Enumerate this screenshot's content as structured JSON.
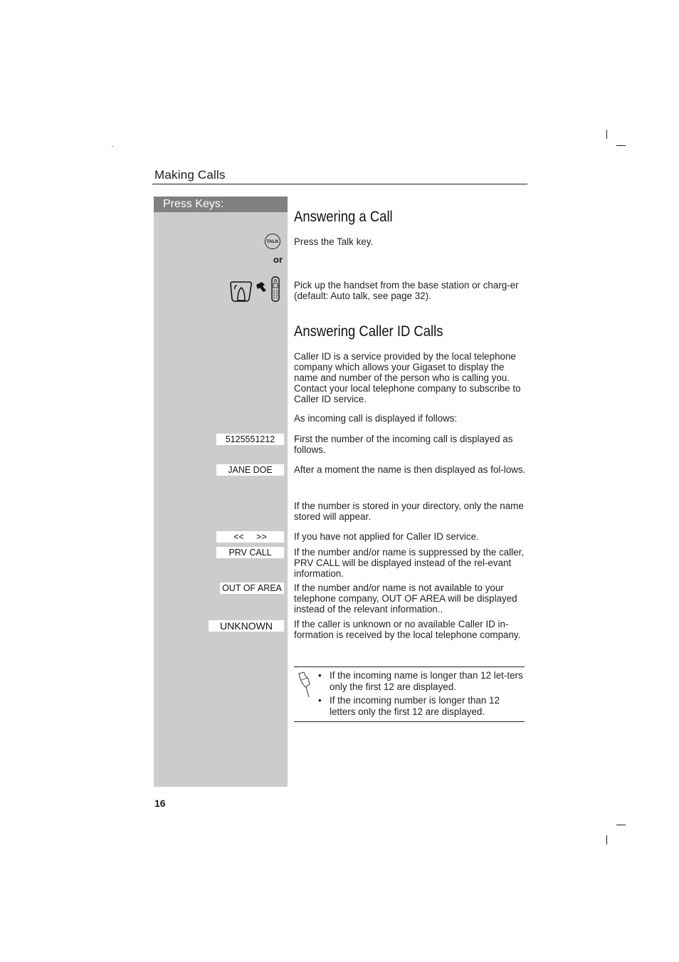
{
  "header": {
    "section_title": "Making Calls"
  },
  "sidebar": {
    "heading": "Press Keys:",
    "or_label": "or",
    "talk_key_label": "TALK"
  },
  "sections": [
    {
      "title": "Answering a Call"
    },
    {
      "title": "Answering Caller ID Calls"
    }
  ],
  "answering": {
    "talk_text": "Press the Talk key.",
    "pickup_text": "Pick up the handset from the base station or charg-er (default: Auto talk, see page 32)."
  },
  "caller_id": {
    "intro": "Caller ID is a service provided by the local telephone company which allows your Gigaset to display the name and number of the person who is calling you. Contact your local telephone company to subscribe to Caller ID service.",
    "as_incoming": "As incoming call is displayed if follows:",
    "rows": [
      {
        "display": "5125551212",
        "text": "First the number of the incoming call is displayed as follows."
      },
      {
        "display": "JANE DOE",
        "text": "After a moment the name is then displayed as fol-lows."
      },
      {
        "display": "",
        "text": "If the number is stored in your directory, only the name stored will appear."
      },
      {
        "display": "<<     >>",
        "text": "If you have not applied for Caller ID service."
      },
      {
        "display": "PRV CALL",
        "text": "If the number and/or name is suppressed by the caller, PRV CALL will be displayed instead of the rel-evant information."
      },
      {
        "display": "OUT OF AREA",
        "text": "If the number and/or name is not available to your telephone company, OUT OF AREA will be displayed instead of the relevant information.."
      },
      {
        "display": "UNKNOWN",
        "text": "If the caller is unknown or no available Caller ID in-formation is received by the local telephone company."
      }
    ]
  },
  "note": {
    "items": [
      "If the incoming name is longer than 12 let-ters only the first 12 are displayed.",
      "If the incoming number is longer than 12 letters only the first 12 are displayed."
    ]
  },
  "footer": {
    "page_number": "16"
  }
}
